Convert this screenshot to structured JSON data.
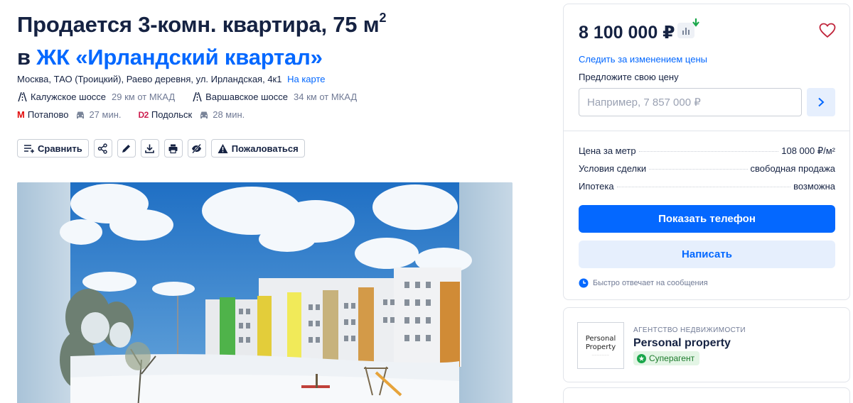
{
  "title": {
    "line1": "Продается 3-комн. квартира, 75 м",
    "sup": "2",
    "prefix": "в ",
    "complex": "ЖК «Ирландский квартал»"
  },
  "address": {
    "text": "Москва, ТАО (Троицкий), Раево деревня, ул. Ирландская, 4к1",
    "map_link": "На карте"
  },
  "highways": [
    {
      "name": "Калужское шоссе",
      "distance": "29 км от МКАД"
    },
    {
      "name": "Варшавское шоссе",
      "distance": "34 км от МКАД"
    }
  ],
  "transport": [
    {
      "icon": "metro-icon",
      "glyph": "М",
      "station": "Потапово",
      "time": "27 мин."
    },
    {
      "icon": "d2-icon",
      "glyph": "D2",
      "station": "Подольск",
      "time": "28 мин."
    }
  ],
  "actions": {
    "compare": "Сравнить",
    "complain": "Пожаловаться"
  },
  "sidebar": {
    "price": "8 100 000 ₽",
    "follow_price": "Следить за изменением цены",
    "offer_label": "Предложите свою цену",
    "offer_placeholder": "Например, 7 857 000 ₽",
    "details": [
      {
        "key": "Цена за метр",
        "value": "108 000 ₽/м²"
      },
      {
        "key": "Условия сделки",
        "value": "свободная продажа"
      },
      {
        "key": "Ипотека",
        "value": "возможна"
      }
    ],
    "show_phone": "Показать телефон",
    "write": "Написать",
    "fast_reply": "Быстро отвечает на сообщения"
  },
  "agency": {
    "type": "АГЕНТСТВО НЕДВИЖИМОСТИ",
    "name": "Personal property",
    "badge": "Суперагент",
    "logo_line1": "Personal",
    "logo_line2": "Property"
  },
  "colors": {
    "accent": "#0468ff",
    "text": "#152242",
    "muted": "#707a95",
    "metro": "#e10b0b",
    "badge_green": "#1b7a2b"
  }
}
